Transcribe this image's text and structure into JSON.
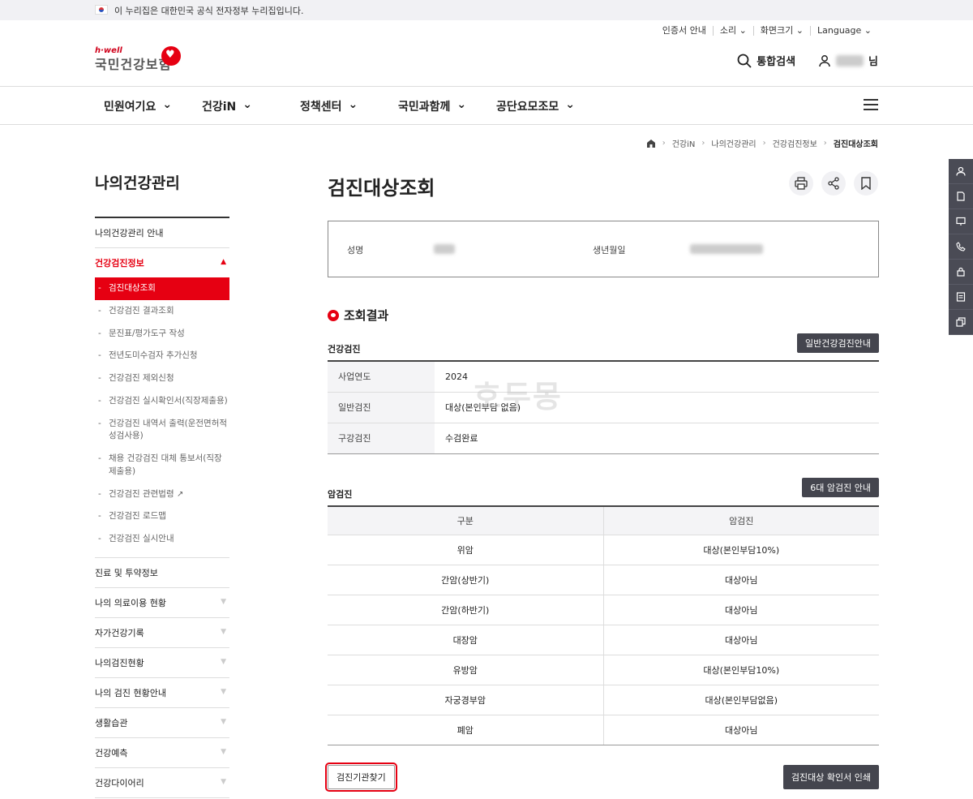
{
  "gov_bar": {
    "text": "이 누리집은 대한민국 공식 전자정부 누리집입니다."
  },
  "util": {
    "cert": "인증서 안내",
    "sound": "소리 ⌄",
    "fontsize": "화면크기 ⌄",
    "language": "Language ⌄"
  },
  "logo": {
    "hwell": "h·well",
    "name": "국민건강보험"
  },
  "header": {
    "search_label": "통합검색",
    "user_suffix": "님"
  },
  "gnb": [
    "민원여기요",
    "건강iN",
    "정책센터",
    "국민과함께",
    "공단요모조모"
  ],
  "breadcrumb": [
    "건강iN",
    "나의건강관리",
    "건강검진정보",
    "검진대상조회"
  ],
  "lnb": {
    "title": "나의건강관리",
    "item_intro": "나의건강관리 안내",
    "item_checkup": "건강검진정보",
    "sub": [
      "검진대상조회",
      "건강검진 결과조회",
      "문진표/평가도구 작성",
      "전년도미수검자 추가신청",
      "건강검진 제외신청",
      "건강검진 실시확인서(직장제출용)",
      "건강검진 내역서 출력(운전면허적성검사용)",
      "채용 건강검진 대체 통보서(직장제출용)",
      "건강검진 관련법령",
      "건강검진 로드맵",
      "건강검진 실시안내"
    ],
    "items_after": [
      "진료 및 투약정보",
      "나의 의료이용 현황",
      "자가건강기록",
      "나의검진현황",
      "나의 검진 현황안내",
      "생활습관",
      "건강예측",
      "건강다이어리"
    ]
  },
  "page": {
    "title": "검진대상조회"
  },
  "info": {
    "name_label": "성명",
    "birth_label": "생년월일"
  },
  "result": {
    "title": "조회결과",
    "health": {
      "title": "건강검진",
      "button": "일반건강검진안내",
      "rows": [
        {
          "label": "사업연도",
          "value": "2024"
        },
        {
          "label": "일반검진",
          "value": "대상(본인부담 없음)"
        },
        {
          "label": "구강검진",
          "value": "수검완료"
        }
      ]
    },
    "cancer": {
      "title": "암검진",
      "button": "6대 암검진 안내",
      "headers": [
        "구분",
        "암검진"
      ],
      "rows": [
        [
          "위암",
          "대상(본인부담10%)"
        ],
        [
          "간암(상반기)",
          "대상아님"
        ],
        [
          "간암(하반기)",
          "대상아님"
        ],
        [
          "대장암",
          "대상아님"
        ],
        [
          "유방암",
          "대상(본인부담10%)"
        ],
        [
          "자궁경부암",
          "대상(본인부담없음)"
        ],
        [
          "폐암",
          "대상아님"
        ]
      ]
    }
  },
  "watermark": "호두몽",
  "buttons": {
    "find_center": "검진기관찾기",
    "print_confirm": "검진대상 확인서 인쇄"
  },
  "colors": {
    "accent": "#e60012",
    "dark_button": "#44454e"
  }
}
